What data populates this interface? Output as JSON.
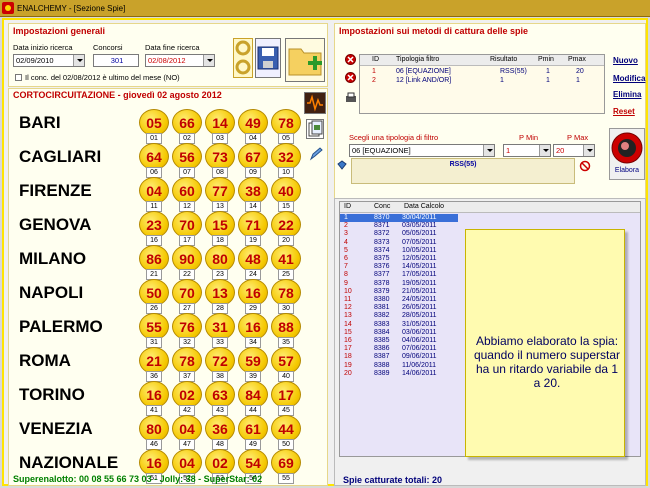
{
  "window": {
    "title": "ENALCHEMY - [Sezione Spie]"
  },
  "general": {
    "title": "Impostazioni generali",
    "start_label": "Data inizio ricerca",
    "start_value": "02/09/2010",
    "contests_label": "Concorsi",
    "contests_value": "301",
    "end_label": "Data fine ricerca",
    "end_value": "02/08/2012",
    "last_month_label": "Il conc. del 02/08/2012 è ultimo del mese (NO)"
  },
  "draw": {
    "title": "CORTOCIRCUITAZIONE - giovedì 02 agosto 2012",
    "wheels": [
      {
        "name": "BARI",
        "nums": [
          "05",
          "66",
          "14",
          "49",
          "78"
        ],
        "subs": [
          "01",
          "02",
          "03",
          "04",
          "05"
        ]
      },
      {
        "name": "CAGLIARI",
        "nums": [
          "64",
          "56",
          "73",
          "67",
          "32"
        ],
        "subs": [
          "06",
          "07",
          "08",
          "09",
          "10"
        ]
      },
      {
        "name": "FIRENZE",
        "nums": [
          "04",
          "60",
          "77",
          "38",
          "40"
        ],
        "subs": [
          "11",
          "12",
          "13",
          "14",
          "15"
        ]
      },
      {
        "name": "GENOVA",
        "nums": [
          "23",
          "70",
          "15",
          "71",
          "22"
        ],
        "subs": [
          "16",
          "17",
          "18",
          "19",
          "20"
        ]
      },
      {
        "name": "MILANO",
        "nums": [
          "86",
          "90",
          "80",
          "48",
          "41"
        ],
        "subs": [
          "21",
          "22",
          "23",
          "24",
          "25"
        ]
      },
      {
        "name": "NAPOLI",
        "nums": [
          "50",
          "70",
          "13",
          "16",
          "78"
        ],
        "subs": [
          "26",
          "27",
          "28",
          "29",
          "30"
        ]
      },
      {
        "name": "PALERMO",
        "nums": [
          "55",
          "76",
          "31",
          "16",
          "88"
        ],
        "subs": [
          "31",
          "32",
          "33",
          "34",
          "35"
        ]
      },
      {
        "name": "ROMA",
        "nums": [
          "21",
          "78",
          "72",
          "59",
          "57"
        ],
        "subs": [
          "36",
          "37",
          "38",
          "39",
          "40"
        ]
      },
      {
        "name": "TORINO",
        "nums": [
          "16",
          "02",
          "63",
          "84",
          "17"
        ],
        "subs": [
          "41",
          "42",
          "43",
          "44",
          "45"
        ]
      },
      {
        "name": "VENEZIA",
        "nums": [
          "80",
          "04",
          "36",
          "61",
          "44"
        ],
        "subs": [
          "46",
          "47",
          "48",
          "49",
          "50"
        ]
      },
      {
        "name": "NAZIONALE",
        "nums": [
          "16",
          "04",
          "02",
          "54",
          "69"
        ],
        "subs": [
          "51",
          "52",
          "53",
          "54",
          "55"
        ]
      }
    ],
    "footer": "Superenalotto: 00 08 55 66 73 03 - Jolly: 38 - SuperStar: 02"
  },
  "methods": {
    "title": "Impostazioni sui metodi di cattura delle spie",
    "headers": [
      "ID",
      "Tipologia filtro",
      "Risultato",
      "Pmin",
      "Pmax"
    ],
    "rows": [
      {
        "id": "1",
        "tipo": "06 [EQUAZIONE]",
        "ris": "RSS(55)",
        "pmin": "1",
        "pmax": "20"
      },
      {
        "id": "2",
        "tipo": "12 [Link AND/OR]",
        "ris": "1",
        "pmin": "1",
        "pmax": "1"
      }
    ],
    "links": {
      "new": "Nuovo",
      "edit": "Modifica",
      "delete": "Elimina",
      "reset": "Reset"
    },
    "choose_label": "Scegli una tipologia di filtro",
    "choose_value": "06 [EQUAZIONE]",
    "pmin_label": "P Min",
    "pmin_value": "1",
    "pmax_label": "P Max",
    "pmax_value": "20",
    "expr": "RSS(55)",
    "elabora": "Elabora"
  },
  "results": {
    "headers": [
      "ID",
      "Conc",
      "Data Calcolo"
    ],
    "rows": [
      [
        "1",
        "8370",
        "30/04/2011"
      ],
      [
        "2",
        "8371",
        "03/05/2011"
      ],
      [
        "3",
        "8372",
        "05/05/2011"
      ],
      [
        "4",
        "8373",
        "07/05/2011"
      ],
      [
        "5",
        "8374",
        "10/05/2011"
      ],
      [
        "6",
        "8375",
        "12/05/2011"
      ],
      [
        "7",
        "8376",
        "14/05/2011"
      ],
      [
        "8",
        "8377",
        "17/05/2011"
      ],
      [
        "9",
        "8378",
        "19/05/2011"
      ],
      [
        "10",
        "8379",
        "21/05/2011"
      ],
      [
        "11",
        "8380",
        "24/05/2011"
      ],
      [
        "12",
        "8381",
        "26/05/2011"
      ],
      [
        "13",
        "8382",
        "28/05/2011"
      ],
      [
        "14",
        "8383",
        "31/05/2011"
      ],
      [
        "15",
        "8384",
        "03/06/2011"
      ],
      [
        "16",
        "8385",
        "04/06/2011"
      ],
      [
        "17",
        "8386",
        "07/06/2011"
      ],
      [
        "18",
        "8387",
        "09/06/2011"
      ],
      [
        "19",
        "8388",
        "11/06/2011"
      ],
      [
        "20",
        "8389",
        "14/06/2011"
      ]
    ],
    "note": "Abbiamo elaborato la spia: quando il numero superstar ha un ritardo variabile da 1 a 20.",
    "total": "Spie catturate totali: 20"
  },
  "colors": {
    "accent": "#c00000",
    "selected_row": "#3a6fd8",
    "grid": "#e8e4f8"
  }
}
